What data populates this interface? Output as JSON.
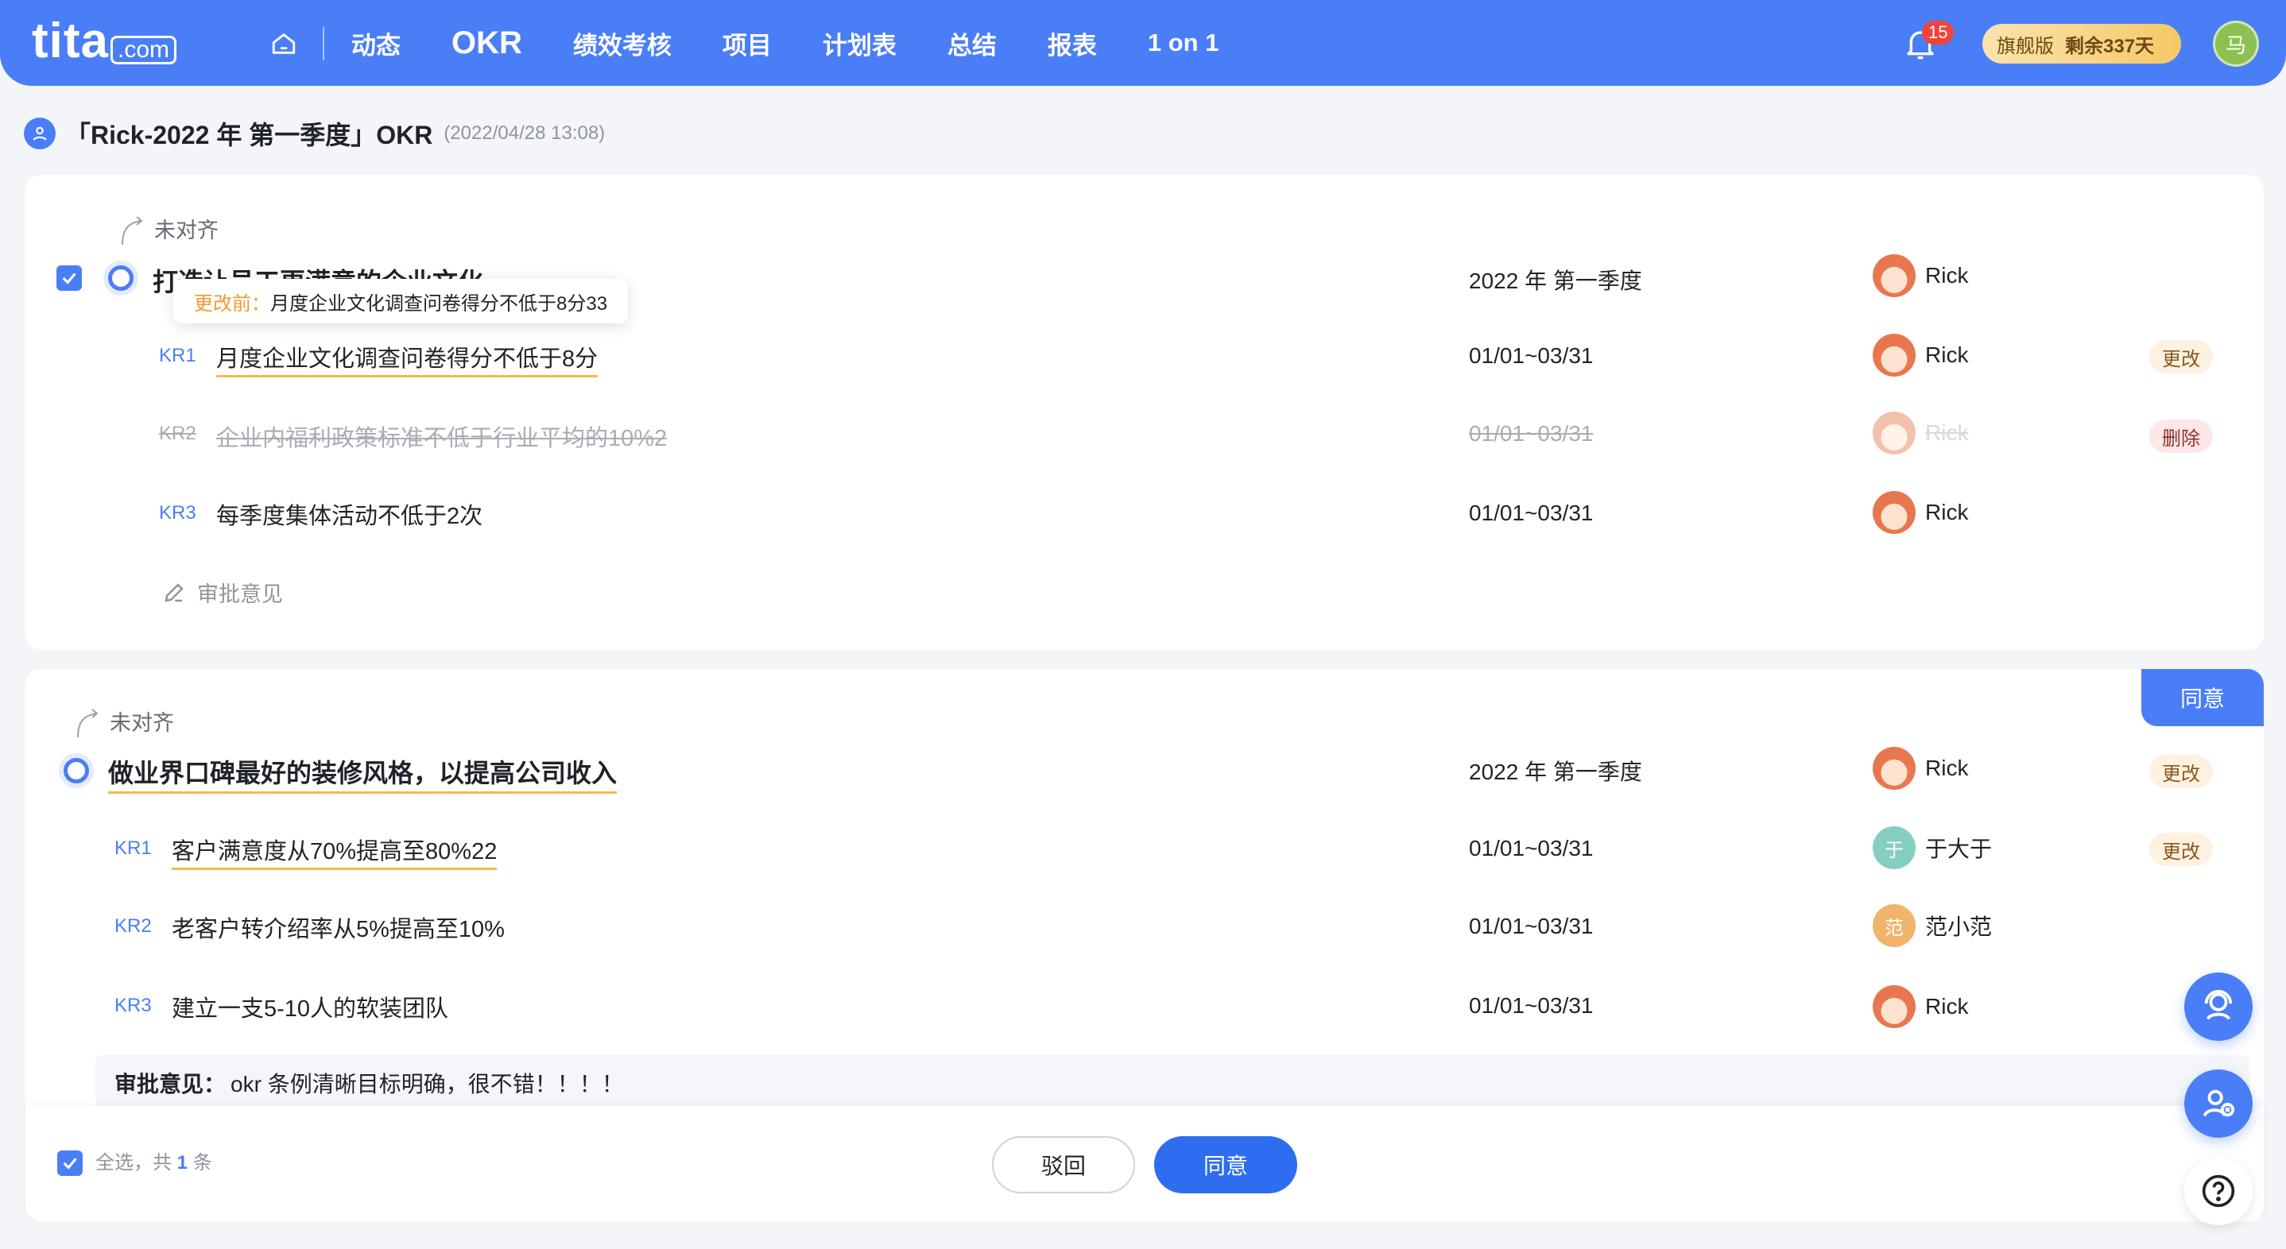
{
  "nav": {
    "logo_main": "tita",
    "logo_sub": ".com",
    "items": [
      {
        "label": "动态"
      },
      {
        "label": "OKR"
      },
      {
        "label": "绩效考核"
      },
      {
        "label": "项目"
      },
      {
        "label": "计划表"
      },
      {
        "label": "总结"
      },
      {
        "label": "报表"
      },
      {
        "label": "1 on 1"
      }
    ],
    "active": "OKR",
    "notification_count": "15",
    "plan_name": "旗舰版",
    "plan_remaining": "剩余337天",
    "user_initial": "马"
  },
  "page": {
    "title": "「Rick-2022 年 第一季度」OKR",
    "timestamp": "(2022/04/28 13:08)"
  },
  "objectives": [
    {
      "align_note": "未对齐",
      "title": "打造让员工更满意的企业文化",
      "cycle": "2022 年 第一季度",
      "owner": "Rick",
      "tooltip_label": "更改前：",
      "tooltip_text": "月度企业文化调查问卷得分不低于8分33",
      "krs": [
        {
          "tag": "KR1",
          "text": "月度企业文化调查问卷得分不低于8分",
          "date": "01/01~03/31",
          "owner": "Rick",
          "status": "更改"
        },
        {
          "tag": "KR2",
          "text": "企业内福利政策标准不低于行业平均的10%2",
          "date": "01/01~03/31",
          "owner": "Rick",
          "status": "删除"
        },
        {
          "tag": "KR3",
          "text": "每季度集体活动不低于2次",
          "date": "01/01~03/31",
          "owner": "Rick",
          "status": ""
        }
      ],
      "approve_note": "审批意见"
    },
    {
      "align_note": "未对齐",
      "title": "做业界口碑最好的装修风格，以提高公司收入",
      "cycle": "2022 年 第一季度",
      "owner": "Rick",
      "status": "更改",
      "corner_label": "同意",
      "krs": [
        {
          "tag": "KR1",
          "text": "客户满意度从70%提高至80%22",
          "date": "01/01~03/31",
          "owner": "于大于",
          "owner_initial": "于",
          "status": "更改"
        },
        {
          "tag": "KR2",
          "text": "老客户转介绍率从5%提高至10%",
          "date": "01/01~03/31",
          "owner": "范小范",
          "owner_initial": "范",
          "status": ""
        },
        {
          "tag": "KR3",
          "text": "建立一支5-10人的软装团队",
          "date": "01/01~03/31",
          "owner": "Rick",
          "status": ""
        }
      ],
      "comment_label": "审批意见：",
      "comment_text": "okr 条例清晰目标明确，很不错！！！！"
    }
  ],
  "footer": {
    "select_all": "全选，共",
    "count": "1",
    "unit": "条",
    "reject_label": "驳回",
    "agree_label": "同意"
  },
  "colors": {
    "primary": "#4a7ef6",
    "highlight_underline": "#f6b94a",
    "badge_red": "#f0433c"
  }
}
